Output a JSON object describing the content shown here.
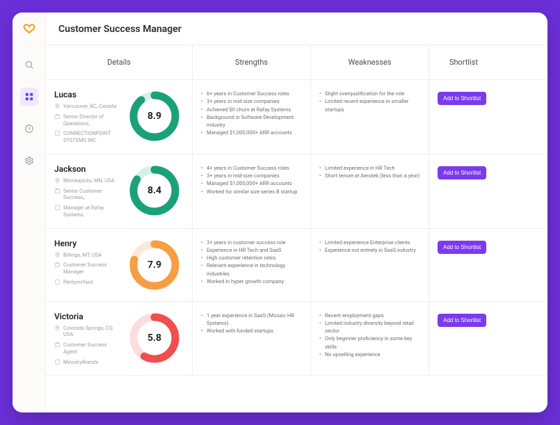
{
  "header": {
    "title": "Customer Success Manager"
  },
  "columns": {
    "details": "Details",
    "strengths": "Strengths",
    "weaknesses": "Weaknesses",
    "shortlist": "Shortlist"
  },
  "shortlist_button_label": "Add to Shortlist",
  "candidates": [
    {
      "name": "Lucas",
      "location": "Vancouver, BC, Canada",
      "role": "Senior Director of Operations,",
      "company": "CONNECTIONPOINT SYSTEMS INC.",
      "score": "8.9",
      "score_pct": 89,
      "color": "#1aa179",
      "track": "#d5f1e7",
      "strengths": [
        "6+ years in Customer Success roles",
        "3+ years in mid-size companies",
        "Achieved $0 churn at Rafay Systems",
        "Background in Software Development industry",
        "Managed $1,000,000+ ARR accounts"
      ],
      "weaknesses": [
        "Slight overqualification for the role",
        "Limited recent experience in smaller startups"
      ]
    },
    {
      "name": "Jackson",
      "location": "Minneapolis, MN, USA",
      "role": "Senior Customer Success,,",
      "company": "Manager at Rafay Systems,",
      "score": "8.4",
      "score_pct": 84,
      "color": "#1aa179",
      "track": "#d5f1e7",
      "strengths": [
        "4+ years in Customer Success roles",
        "3+ years in mid-size companies",
        "Managed $1,000,000+ ARR accounts",
        "Worked for similar size series B startup"
      ],
      "weaknesses": [
        "Limited experience in HR Tech",
        "Short tenure at Aerotek (less than a year)"
      ]
    },
    {
      "name": "Henry",
      "location": "Billings, MT, USA",
      "role": "Customer Success Manager",
      "company": "PerformYard",
      "score": "7.9",
      "score_pct": 79,
      "color": "#f59e42",
      "track": "#fde9d6",
      "strengths": [
        "3+ years in customer success role",
        "Experience in HR Tech and SaaS",
        "High customer retention rates",
        "Relevant experience in technology industries",
        "Worked in hyper growth company"
      ],
      "weaknesses": [
        "Limited experience Enterprise clients",
        "Experience not entirely in SaaS industry"
      ]
    },
    {
      "name": "Victoria",
      "location": "Colorado Springs, CO, USA",
      "role": "Customer Success Agent",
      "company": "MinistryBrands",
      "score": "5.8",
      "score_pct": 58,
      "color": "#ef4f4f",
      "track": "#fbdddd",
      "strengths": [
        "1 year experience in SaaS (Mosaic HR Systems)",
        "Worked with funded startups"
      ],
      "weaknesses": [
        "Recent employment gaps",
        "Limited industry diversity beyond retail sector",
        "Only beginner proficiency in some key skills",
        "No upselling experience"
      ]
    }
  ]
}
